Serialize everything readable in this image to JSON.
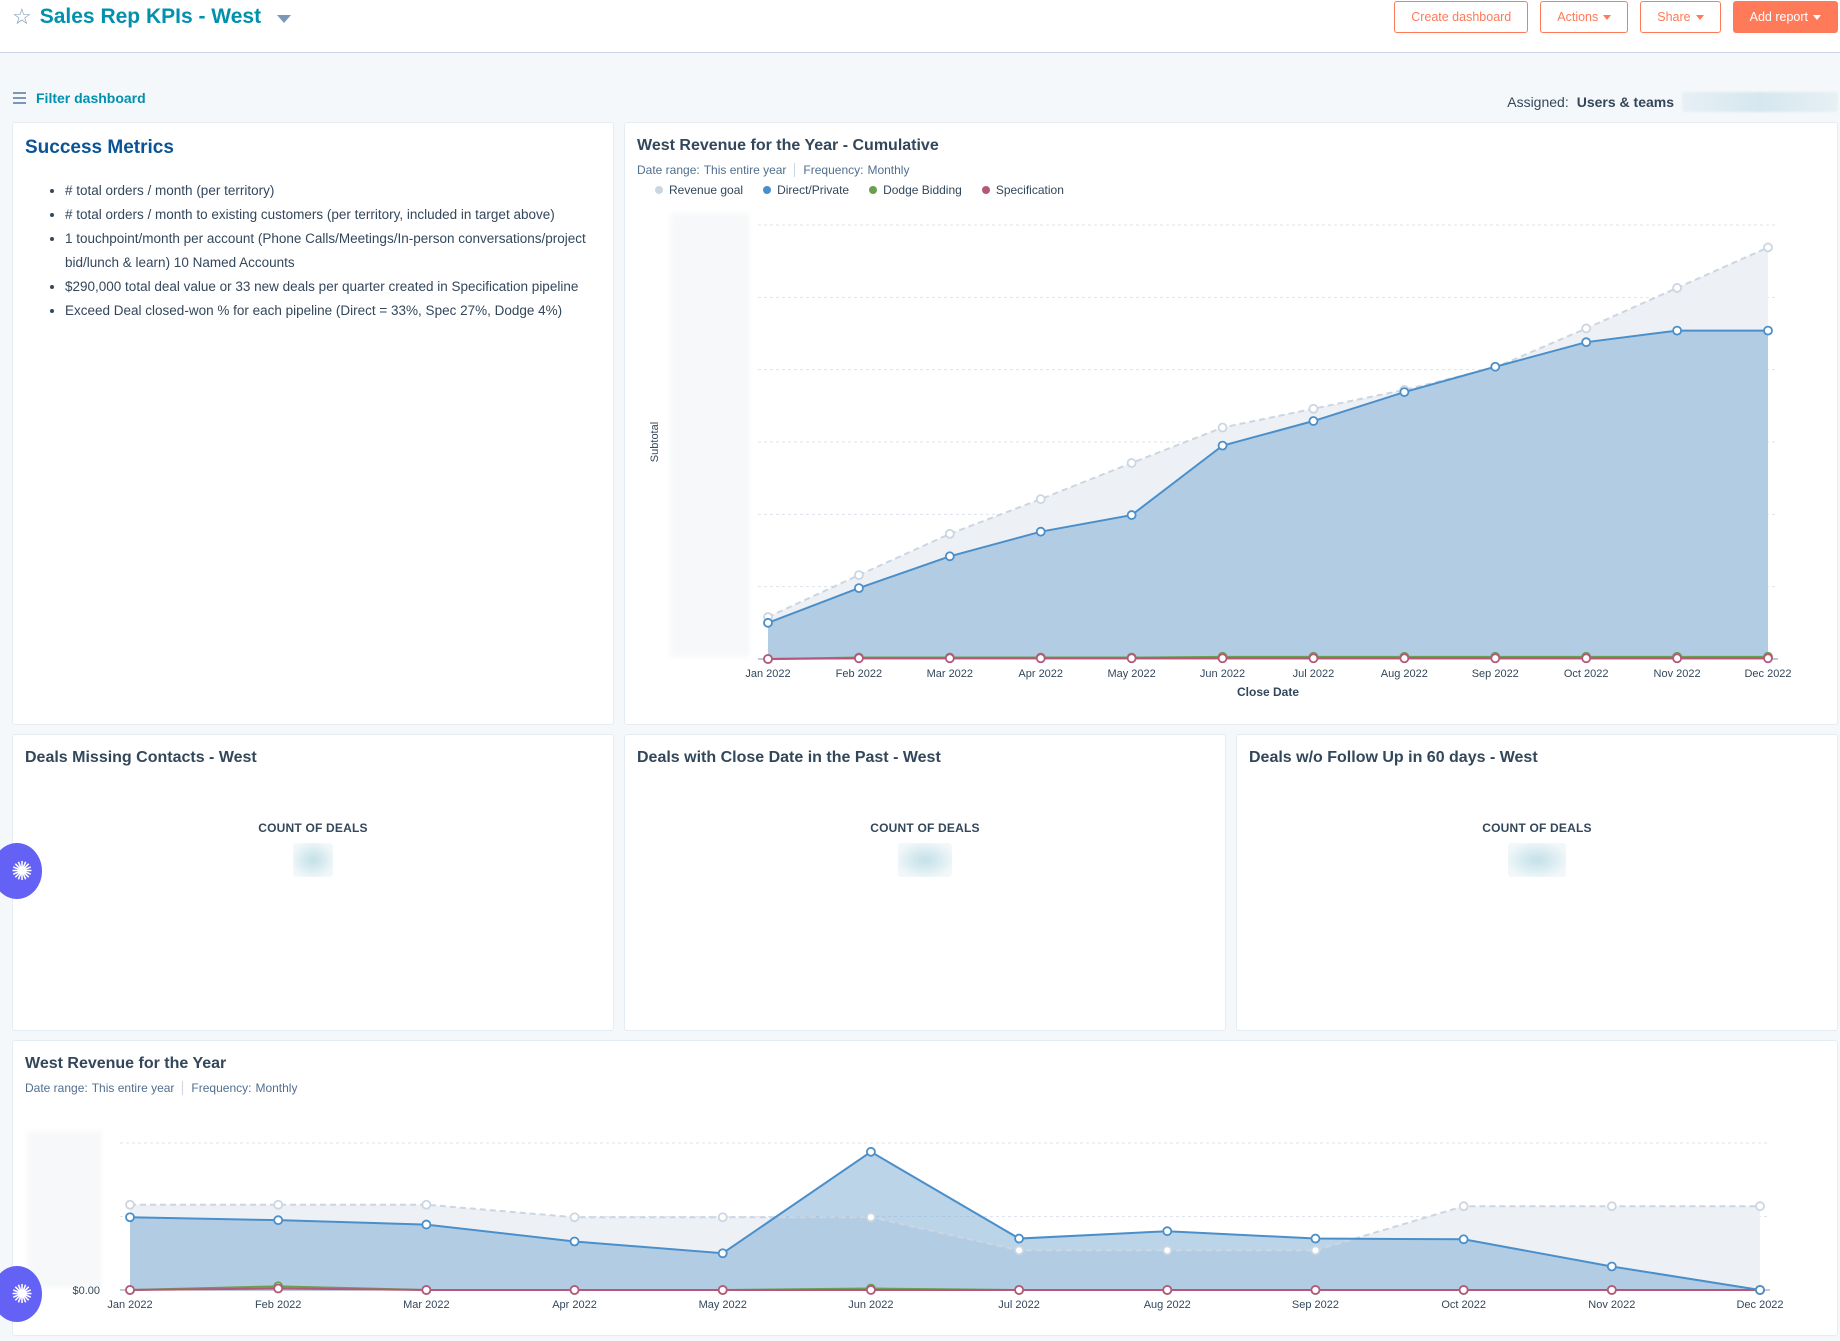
{
  "header": {
    "title": "Sales Rep KPIs - West",
    "buttons": {
      "create_dashboard": "Create dashboard",
      "actions": "Actions",
      "share": "Share",
      "add_report": "Add report"
    }
  },
  "filterbar": {
    "filter_label": "Filter dashboard",
    "assigned_label": "Assigned:",
    "assigned_value": "Users & teams"
  },
  "colors": {
    "accent": "#0091ae",
    "primary_button": "#ff7a59",
    "revenue_goal": "#cbd6e2",
    "direct_private": "#4a8fca",
    "dodge_bidding": "#6a9f4e",
    "specification": "#b5577a"
  },
  "success_metrics": {
    "title": "Success Metrics",
    "items": [
      "# total orders / month (per territory)",
      "# total orders / month to existing customers (per territory, included in target above)",
      "1 touchpoint/month per account (Phone Calls/Meetings/In-person conversations/project bid/lunch & learn) 10 Named Accounts",
      "$290,000 total deal value or 33 new deals per quarter created in Specification pipeline",
      "Exceed Deal closed-won % for each pipeline (Direct = 33%, Spec 27%, Dodge 4%)"
    ]
  },
  "cumulative_card": {
    "title": "West Revenue for the Year - Cumulative",
    "date_range_label": "Date range:",
    "date_range_value": "This entire year",
    "frequency_label": "Frequency:",
    "frequency_value": "Monthly"
  },
  "kpi_cards": [
    {
      "title": "Deals Missing Contacts - West",
      "label": "COUNT OF DEALS"
    },
    {
      "title": "Deals with Close Date in the Past - West",
      "label": "COUNT OF DEALS"
    },
    {
      "title": "Deals w/o Follow Up in 60 days - West",
      "label": "COUNT OF DEALS"
    }
  ],
  "yearly_card": {
    "title": "West Revenue for the Year",
    "date_range_label": "Date range:",
    "date_range_value": "This entire year",
    "frequency_label": "Frequency:",
    "frequency_value": "Monthly"
  },
  "chart_data": [
    {
      "type": "area",
      "title": "West Revenue for the Year - Cumulative",
      "xlabel": "Close Date",
      "ylabel": "Subtotal",
      "note": "y-axis tick labels are blurred in the screenshot; values are relative (gridline units)",
      "ylim": [
        0,
        6
      ],
      "grid": true,
      "legend": "top-left",
      "categories": [
        "Jan 2022",
        "Feb 2022",
        "Mar 2022",
        "Apr 2022",
        "May 2022",
        "Jun 2022",
        "Jul 2022",
        "Aug 2022",
        "Sep 2022",
        "Oct 2022",
        "Nov 2022",
        "Dec 2022"
      ],
      "series": [
        {
          "name": "Revenue goal",
          "values": [
            0.58,
            1.16,
            1.73,
            2.21,
            2.71,
            3.2,
            3.46,
            3.72,
            4.03,
            4.57,
            5.13,
            5.69
          ]
        },
        {
          "name": "Direct/Private",
          "values": [
            0.5,
            0.98,
            1.42,
            1.76,
            1.99,
            2.95,
            3.29,
            3.69,
            4.04,
            4.38,
            4.54,
            4.54
          ]
        },
        {
          "name": "Dodge Bidding",
          "values": [
            0.0,
            0.02,
            0.02,
            0.02,
            0.02,
            0.03,
            0.03,
            0.03,
            0.03,
            0.03,
            0.03,
            0.03
          ]
        },
        {
          "name": "Specification",
          "values": [
            0.0,
            0.01,
            0.01,
            0.01,
            0.01,
            0.01,
            0.01,
            0.01,
            0.01,
            0.01,
            0.01,
            0.01
          ]
        }
      ]
    },
    {
      "type": "area",
      "title": "West Revenue for the Year",
      "xlabel": "",
      "ylabel": "",
      "note": "only the $0.00 tick is legible; other values relative (gridline units)",
      "y_tick_labels": [
        "$0.00"
      ],
      "ylim": [
        0,
        2
      ],
      "grid": true,
      "categories": [
        "Jan 2022",
        "Feb 2022",
        "Mar 2022",
        "Apr 2022",
        "May 2022",
        "Jun 2022",
        "Jul 2022",
        "Aug 2022",
        "Sep 2022",
        "Oct 2022",
        "Nov 2022",
        "Dec 2022"
      ],
      "series": [
        {
          "name": "Revenue goal",
          "values": [
            1.16,
            1.16,
            1.16,
            0.99,
            0.99,
            0.99,
            0.54,
            0.54,
            0.54,
            1.14,
            1.14,
            1.14
          ]
        },
        {
          "name": "Direct/Private",
          "values": [
            0.99,
            0.95,
            0.89,
            0.66,
            0.5,
            1.88,
            0.7,
            0.8,
            0.7,
            0.69,
            0.32,
            0.0
          ]
        },
        {
          "name": "Dodge Bidding",
          "values": [
            0.0,
            0.05,
            0.0,
            0.0,
            0.0,
            0.02,
            0.0,
            0.0,
            0.0,
            0.0,
            0.0,
            0.0
          ]
        },
        {
          "name": "Specification",
          "values": [
            0.0,
            0.02,
            0.0,
            0.0,
            0.0,
            0.0,
            0.0,
            0.0,
            0.0,
            0.0,
            0.0,
            0.0
          ]
        }
      ]
    }
  ]
}
